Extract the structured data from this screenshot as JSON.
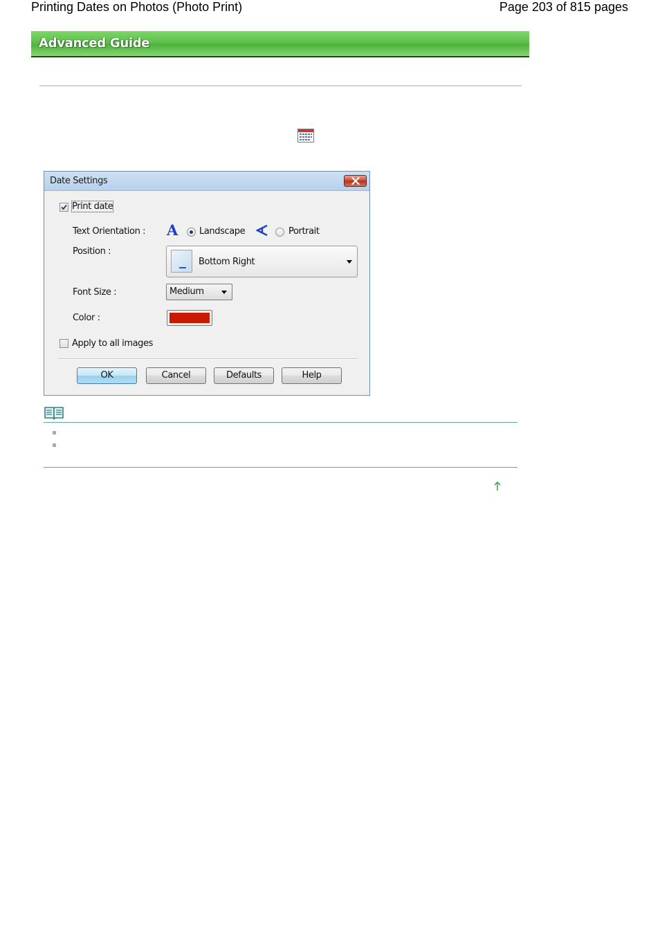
{
  "header": {
    "title": "Printing Dates on Photos (Photo Print)",
    "page_info": "Page 203 of 815 pages"
  },
  "banner": {
    "label": "Advanced Guide"
  },
  "icons": {
    "settings": "calendar-icon",
    "note": "book-icon",
    "top": "up-arrow-icon"
  },
  "dialog": {
    "title": "Date Settings",
    "print_date": {
      "label": "Print date",
      "checked": true
    },
    "text_orientation": {
      "label": "Text Orientation :",
      "landscape_glyph": "A",
      "landscape": "Landscape",
      "portrait": "Portrait",
      "selected": "Landscape"
    },
    "position": {
      "label": "Position :",
      "value": "Bottom Right"
    },
    "font_size": {
      "label": "Font Size :",
      "value": "Medium"
    },
    "color": {
      "label": "Color :",
      "value": "#c81a00"
    },
    "apply_all": {
      "label": "Apply to all images",
      "checked": false
    },
    "buttons": {
      "ok": "OK",
      "cancel": "Cancel",
      "defaults": "Defaults",
      "help": "Help"
    }
  },
  "colors": {
    "banner_green": "#5cc04a",
    "note_rule": "#6aa3a3",
    "dialog_blue": "#b7d1ec"
  }
}
